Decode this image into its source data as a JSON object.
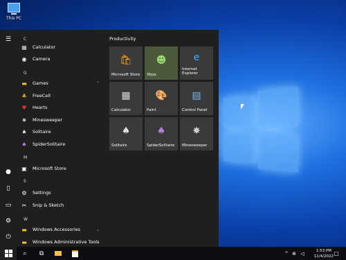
{
  "desktop": {
    "icon_label": "This PC"
  },
  "start_menu": {
    "apps": [
      {
        "type": "header",
        "label": "C"
      },
      {
        "type": "app",
        "label": "Calculator",
        "icon": "calculator-icon"
      },
      {
        "type": "app",
        "label": "Camera",
        "icon": "camera-icon"
      },
      {
        "type": "header",
        "label": "G"
      },
      {
        "type": "folder",
        "label": "Games",
        "icon": "folder-icon",
        "expanded": true
      },
      {
        "type": "app",
        "label": "FreeCell",
        "icon": "freecell-icon"
      },
      {
        "type": "app",
        "label": "Hearts",
        "icon": "hearts-icon"
      },
      {
        "type": "app",
        "label": "Minesweeper",
        "icon": "minesweeper-icon"
      },
      {
        "type": "app",
        "label": "Solitaire",
        "icon": "solitaire-icon"
      },
      {
        "type": "app",
        "label": "SpiderSolitaire",
        "icon": "spider-solitaire-icon"
      },
      {
        "type": "header",
        "label": "M"
      },
      {
        "type": "app",
        "label": "Microsoft Store",
        "icon": "store-icon"
      },
      {
        "type": "header",
        "label": "S"
      },
      {
        "type": "app",
        "label": "Settings",
        "icon": "settings-icon"
      },
      {
        "type": "app",
        "label": "Snip & Sketch",
        "icon": "snip-icon"
      },
      {
        "type": "header",
        "label": "W"
      },
      {
        "type": "folder",
        "label": "Windows Accessories",
        "icon": "folder-icon",
        "expanded": false
      },
      {
        "type": "folder",
        "label": "Windows Administrative Tools",
        "icon": "folder-icon",
        "expanded": false
      }
    ],
    "tiles_group_title": "Productivity",
    "tiles": [
      {
        "label": "Microsoft Store",
        "icon": "store-icon"
      },
      {
        "label": "Xbox",
        "icon": "xbox-icon"
      },
      {
        "label": "Internet Explorer",
        "icon": "ie-icon"
      },
      {
        "label": "Calculator",
        "icon": "calculator-icon"
      },
      {
        "label": "Paint",
        "icon": "paint-icon"
      },
      {
        "label": "Control Panel",
        "icon": "control-panel-icon"
      },
      {
        "label": "Solitaire",
        "icon": "solitaire-icon"
      },
      {
        "label": "SpiderSolitaire",
        "icon": "spider-solitaire-icon"
      },
      {
        "label": "Minesweeper",
        "icon": "minesweeper-icon"
      }
    ]
  },
  "taskbar": {
    "time": "1:53 PM",
    "date": "11/4/2022"
  }
}
